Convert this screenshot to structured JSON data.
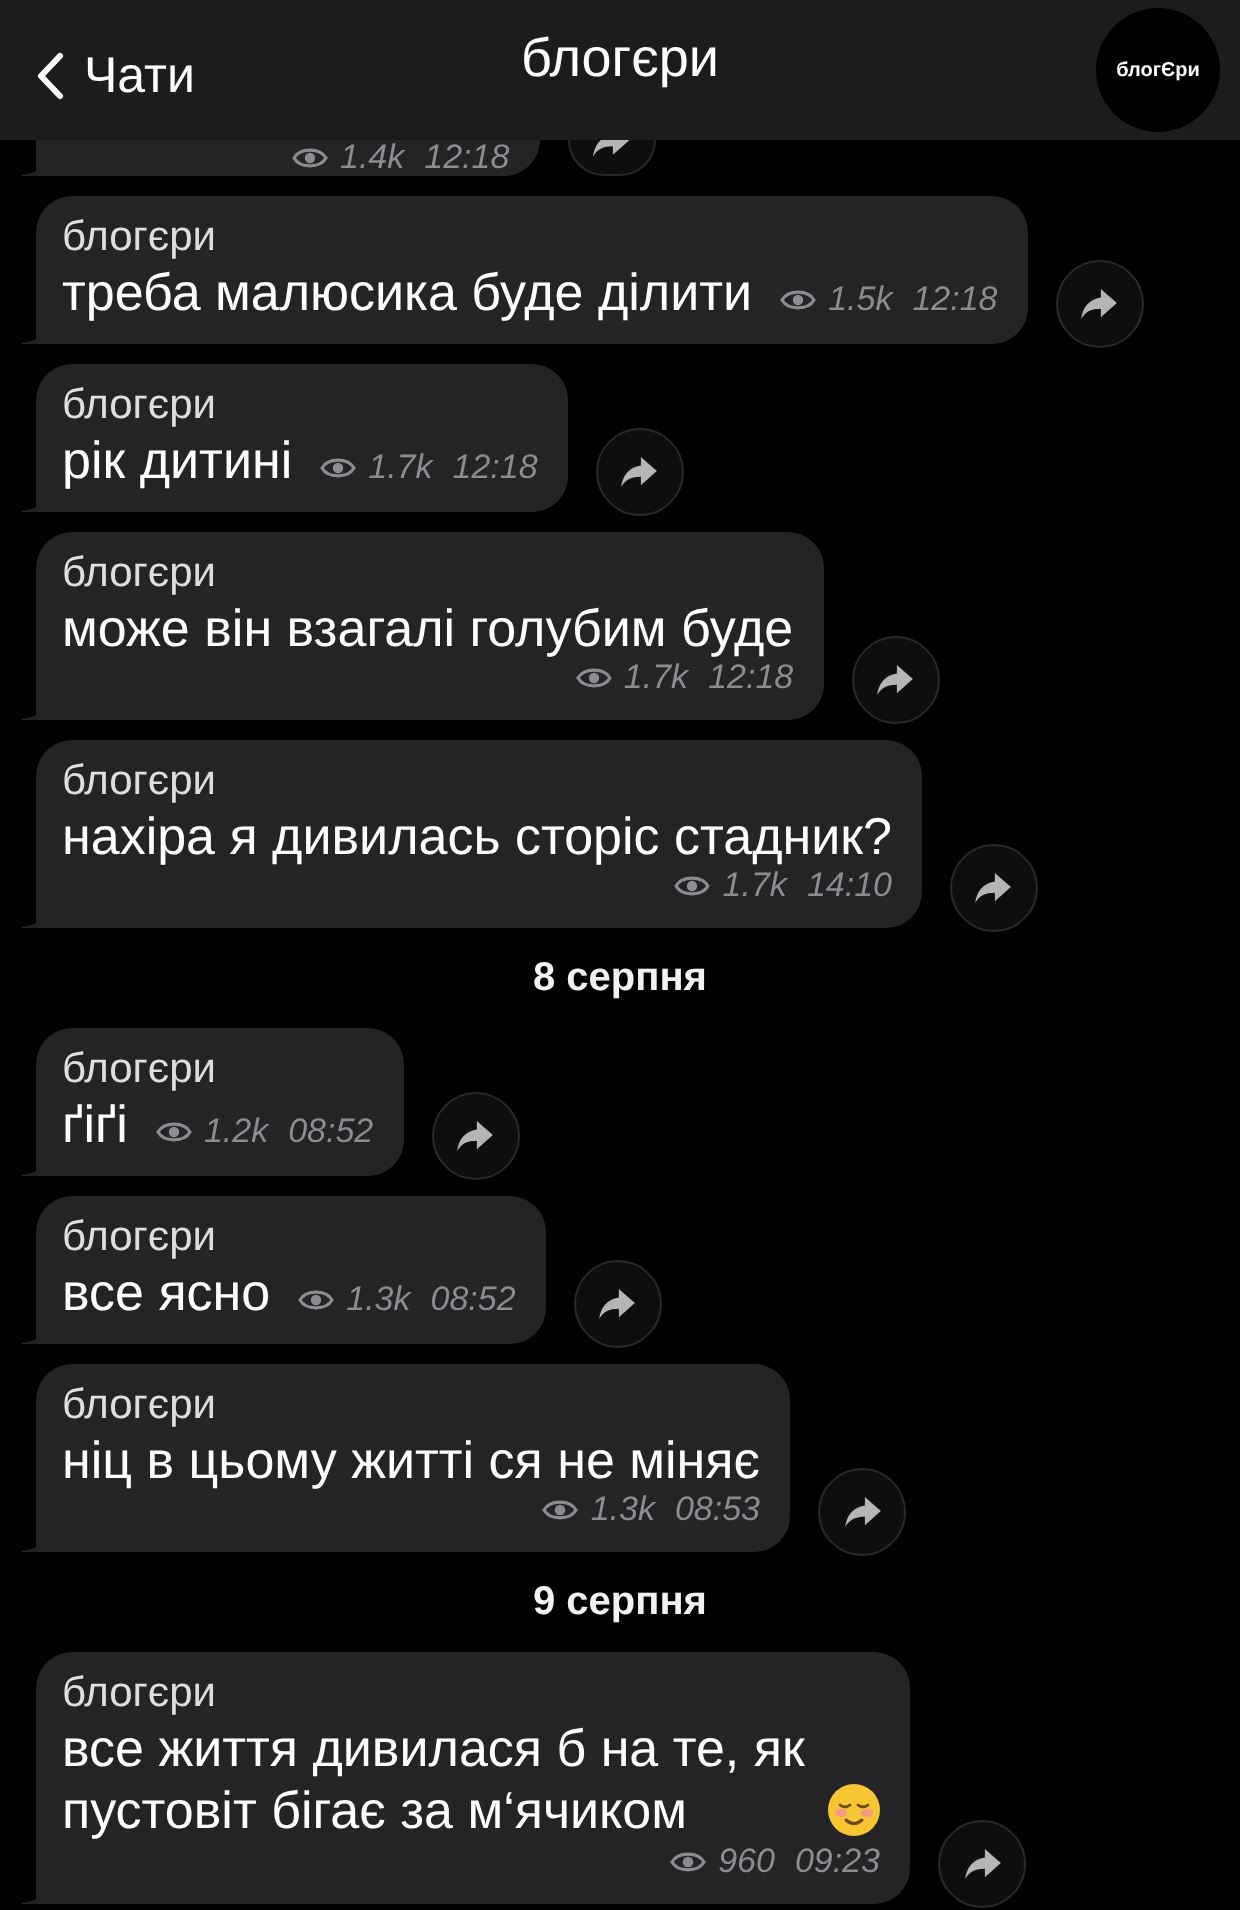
{
  "header": {
    "back_label": "Чати",
    "title": "блогєри",
    "avatar_text": "блогЄри"
  },
  "items": [
    {
      "kind": "partial",
      "views": "1.4k",
      "time": "12:18"
    },
    {
      "kind": "message",
      "meta_below": false,
      "sender": "блогєри",
      "text": "треба малюсика буде ділити",
      "emoji": false,
      "views": "1.5k",
      "time": "12:18"
    },
    {
      "kind": "message",
      "meta_below": false,
      "sender": "блогєри",
      "text": "рік дитині",
      "emoji": false,
      "views": "1.7k",
      "time": "12:18"
    },
    {
      "kind": "message",
      "meta_below": true,
      "sender": "блогєри",
      "text": "може він взагалі голубим буде",
      "emoji": false,
      "views": "1.7k",
      "time": "12:18"
    },
    {
      "kind": "message",
      "meta_below": true,
      "sender": "блогєри",
      "text": "нахіра я дивилась сторіс стадник?",
      "emoji": false,
      "views": "1.7k",
      "time": "14:10"
    },
    {
      "kind": "date",
      "text": "8 серпня"
    },
    {
      "kind": "message",
      "meta_below": false,
      "sender": "блогєри",
      "text": "ґіґі",
      "emoji": false,
      "views": "1.2k",
      "time": "08:52"
    },
    {
      "kind": "message",
      "meta_below": false,
      "sender": "блогєри",
      "text": "все ясно",
      "emoji": false,
      "views": "1.3k",
      "time": "08:52"
    },
    {
      "kind": "message",
      "meta_below": true,
      "sender": "блогєри",
      "text": "ніц в цьому житті ся не міняє",
      "emoji": false,
      "views": "1.3k",
      "time": "08:53"
    },
    {
      "kind": "date",
      "text": "9 серпня"
    },
    {
      "kind": "message",
      "meta_below": true,
      "sender": "блогєри",
      "text": "все життя дивилася б на те, як пустовіт бігає за м‘ячиком",
      "emoji": true,
      "views": "960",
      "time": "09:23"
    }
  ]
}
